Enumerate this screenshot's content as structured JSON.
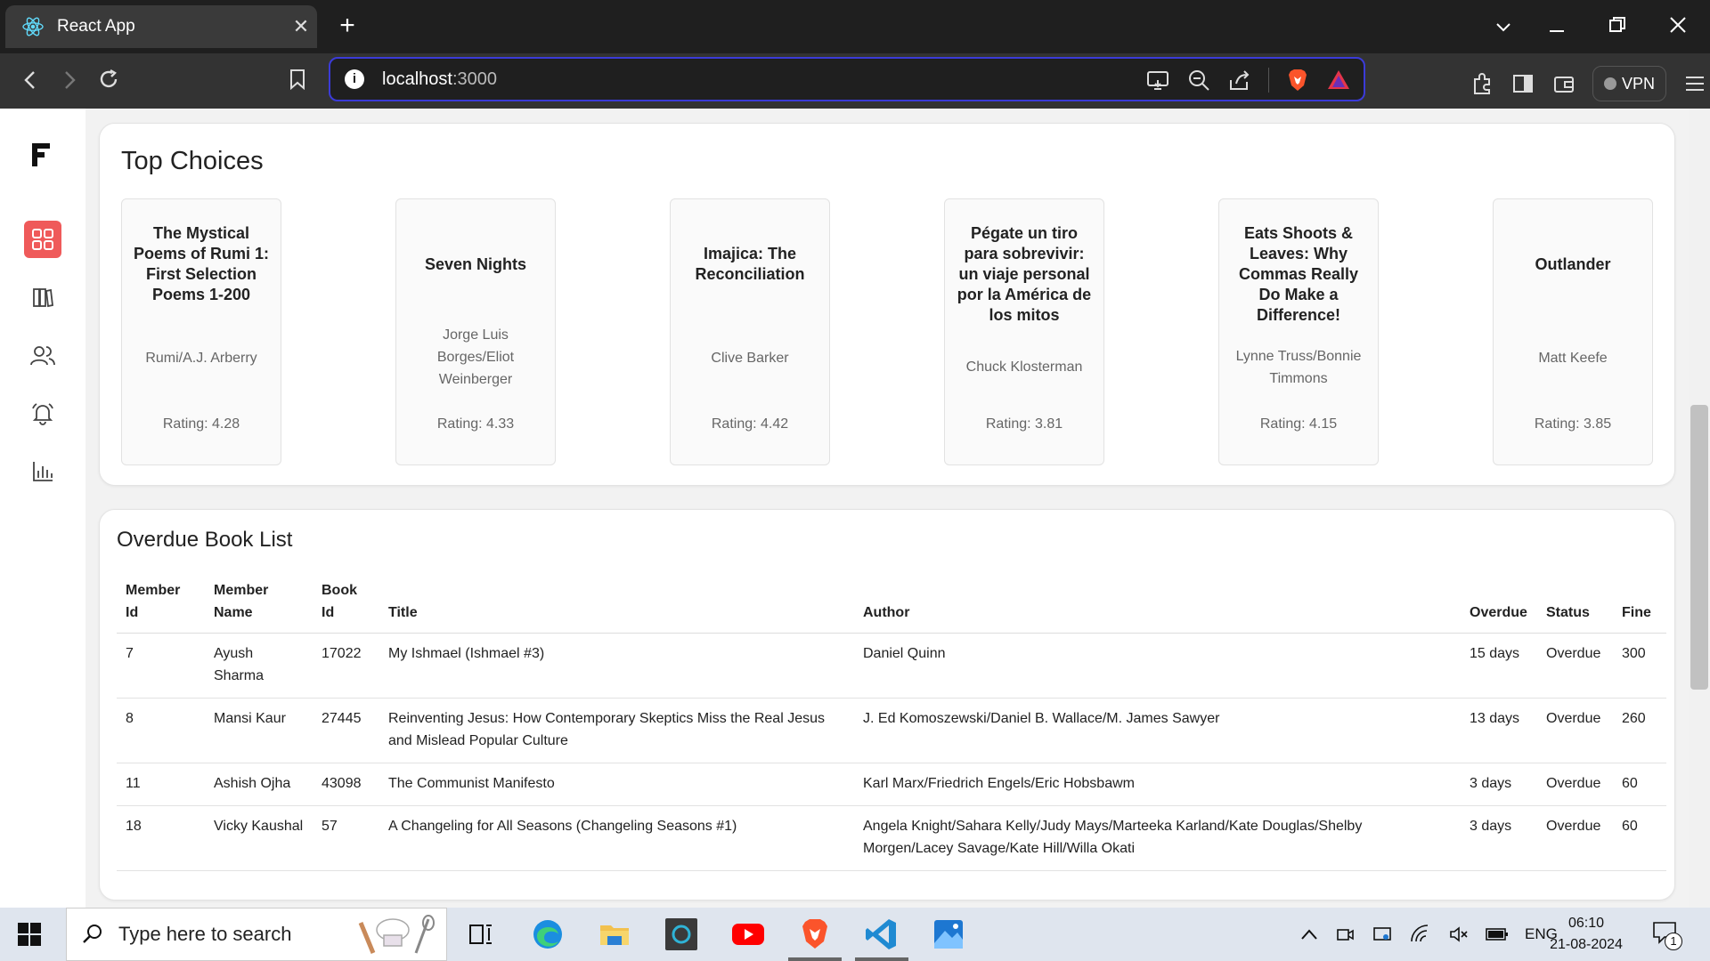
{
  "browser": {
    "tab_title": "React App",
    "tab_close": "✕",
    "new_tab": "+",
    "url_host": "localhost",
    "url_port": ":3000",
    "vpn_label": "VPN"
  },
  "sidebar": {
    "logo": "F",
    "items": [
      {
        "icon": "dashboard-icon",
        "active": true
      },
      {
        "icon": "books-icon",
        "active": false
      },
      {
        "icon": "users-icon",
        "active": false
      },
      {
        "icon": "bell-icon",
        "active": false
      },
      {
        "icon": "bar-chart-icon",
        "active": false
      }
    ]
  },
  "top_choices": {
    "title": "Top Choices",
    "books": [
      {
        "title": "The Mystical Poems of Rumi 1: First Selection Poems 1-200",
        "author": "Rumi/A.J. Arberry",
        "rating": "Rating: 4.28"
      },
      {
        "title": "Seven Nights",
        "author": "Jorge Luis Borges/Eliot Weinberger",
        "rating": "Rating: 4.33"
      },
      {
        "title": "Imajica: The Reconciliation",
        "author": "Clive Barker",
        "rating": "Rating: 4.42"
      },
      {
        "title": "Pégate un tiro para sobrevivir: un viaje personal por la América de los mitos",
        "author": "Chuck Klosterman",
        "rating": "Rating: 3.81"
      },
      {
        "title": "Eats Shoots & Leaves: Why Commas Really Do Make a Difference!",
        "author": "Lynne Truss/Bonnie Timmons",
        "rating": "Rating: 4.15"
      },
      {
        "title": "Outlander",
        "author": "Matt Keefe",
        "rating": "Rating: 3.85"
      }
    ]
  },
  "overdue": {
    "title": "Overdue Book List",
    "columns": {
      "member_id": "Member Id",
      "member_name": "Member Name",
      "book_id": "Book Id",
      "title": "Title",
      "author": "Author",
      "overdue": "Overdue",
      "status": "Status",
      "fine": "Fine"
    },
    "rows": [
      {
        "member_id": "7",
        "member_name": "Ayush Sharma",
        "book_id": "17022",
        "title": "My Ishmael (Ishmael #3)",
        "author": "Daniel Quinn",
        "overdue": "15 days",
        "status": "Overdue",
        "fine": "300"
      },
      {
        "member_id": "8",
        "member_name": "Mansi Kaur",
        "book_id": "27445",
        "title": "Reinventing Jesus: How Contemporary Skeptics Miss the Real Jesus and Mislead Popular Culture",
        "author": "J. Ed Komoszewski/Daniel B. Wallace/M. James Sawyer",
        "overdue": "13 days",
        "status": "Overdue",
        "fine": "260"
      },
      {
        "member_id": "11",
        "member_name": "Ashish Ojha",
        "book_id": "43098",
        "title": "The Communist Manifesto",
        "author": "Karl Marx/Friedrich Engels/Eric Hobsbawm",
        "overdue": "3 days",
        "status": "Overdue",
        "fine": "60"
      },
      {
        "member_id": "18",
        "member_name": "Vicky Kaushal",
        "book_id": "57",
        "title": "A Changeling for All Seasons (Changeling Seasons #1)",
        "author": "Angela Knight/Sahara Kelly/Judy Mays/Marteeka Karland/Kate Douglas/Shelby Morgen/Lacey Savage/Kate Hill/Willa Okati",
        "overdue": "3 days",
        "status": "Overdue",
        "fine": "60"
      }
    ]
  },
  "taskbar": {
    "search_placeholder": "Type here to search",
    "language": "ENG",
    "time": "06:10",
    "date": "21-08-2024",
    "notification_count": "1"
  },
  "colors": {
    "accent": "#ef5a5a",
    "url_border": "#3b3bd8",
    "brave": "#fb542b"
  }
}
